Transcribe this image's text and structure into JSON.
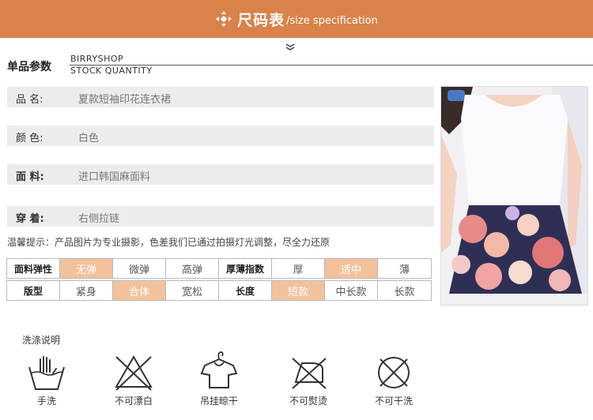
{
  "header": {
    "title": "尺码表",
    "subtitle": "/size specification",
    "color": "#d9834a"
  },
  "product": {
    "section_label": "单品参数",
    "brand_line1": "BIRRYSHOP",
    "brand_line2": "STOCK QUANTITY"
  },
  "info": [
    {
      "label": "品    名:",
      "value": "夏款短袖印花连衣裙"
    },
    {
      "label": "颜  色:",
      "value": "白色"
    },
    {
      "label": "面    料:",
      "value": "进口韩国麻面料"
    },
    {
      "label": "穿    着:",
      "value": "右侧拉链"
    }
  ],
  "notice": "温馨提示：产品图片为专业摄影，色差我们已通过拍摄灯光调整，尽全力还原",
  "spec_table": {
    "highlight_color": "#f3c29c",
    "rows": [
      [
        "面料弹性",
        "无弹",
        "微弹",
        "高弹",
        "厚薄指数",
        "厚",
        "适中",
        "薄"
      ],
      [
        "版型",
        "紧身",
        "合体",
        "宽松",
        "长度",
        "短款",
        "中长款",
        "长款"
      ]
    ]
  },
  "care": {
    "title": "洗涤说明",
    "items": [
      {
        "label": "手洗",
        "icon": "hand-wash-icon"
      },
      {
        "label": "不可漂白",
        "icon": "no-bleach-icon"
      },
      {
        "label": "吊挂晾干",
        "icon": "hang-dry-icon"
      },
      {
        "label": "不可熨烫",
        "icon": "no-iron-icon"
      },
      {
        "label": "不可干洗",
        "icon": "no-dry-clean-icon"
      }
    ]
  }
}
